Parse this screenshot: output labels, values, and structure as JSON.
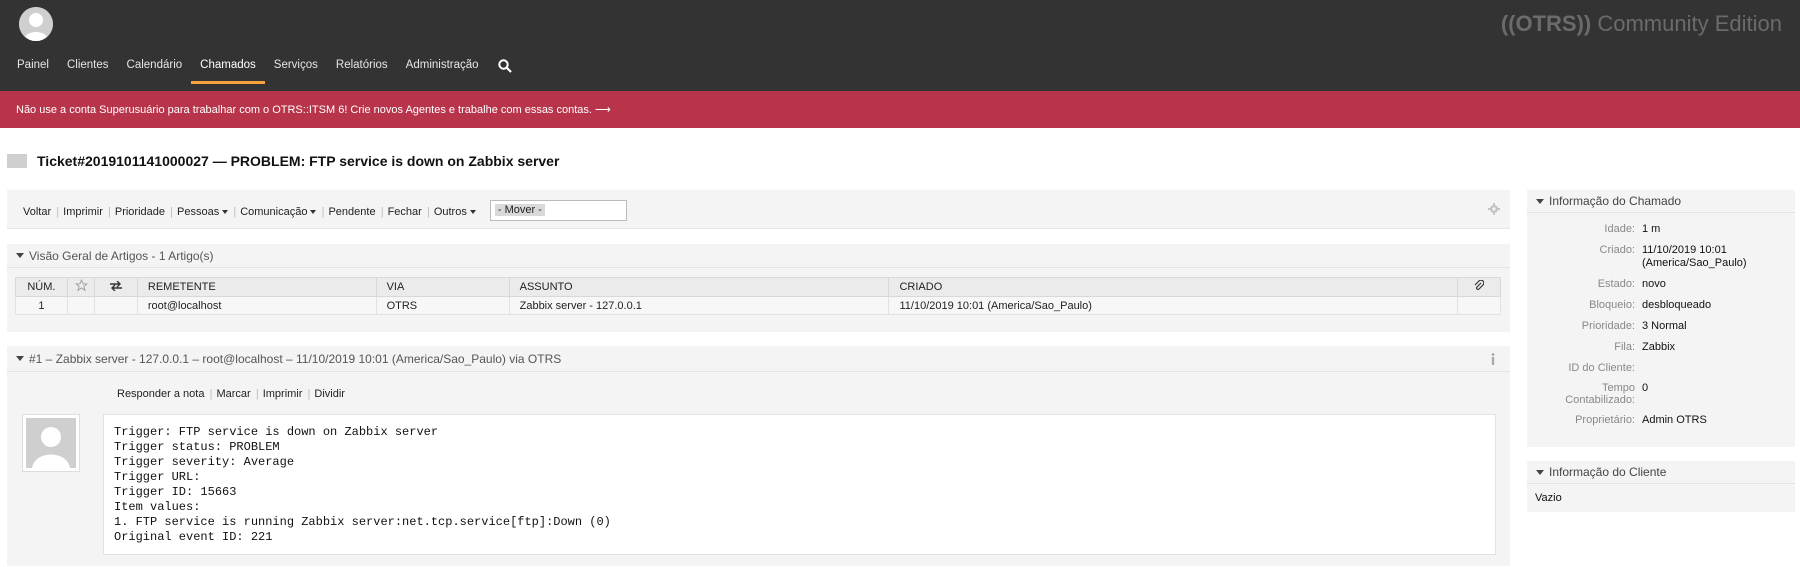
{
  "header": {
    "brand_prefix": "((OTRS))",
    "brand_suffix": " Community Edition",
    "nav": [
      {
        "label": "Painel"
      },
      {
        "label": "Clientes"
      },
      {
        "label": "Calendário"
      },
      {
        "label": "Chamados",
        "active": true
      },
      {
        "label": "Serviços"
      },
      {
        "label": "Relatórios"
      },
      {
        "label": "Administração"
      }
    ],
    "accent_color": "#f7a33b"
  },
  "warning": {
    "text": "Não use a conta Superusuário para trabalhar com o OTRS::ITSM 6! Crie novos Agentes e trabalhe com essas contas. ⟶",
    "color": "#b8344a"
  },
  "ticket": {
    "title": "Ticket#2019101141000027 — PROBLEM: FTP service is down on Zabbix server"
  },
  "actions": {
    "voltar": "Voltar",
    "imprimir": "Imprimir",
    "prioridade": "Prioridade",
    "pessoas": "Pessoas",
    "comunicacao": "Comunicação",
    "pendente": "Pendente",
    "fechar": "Fechar",
    "outros": "Outros",
    "mover": "- Mover -"
  },
  "overview": {
    "title": "Visão Geral de Artigos - 1 Artigo(s)",
    "columns": {
      "num": "NÚM.",
      "remetente": "REMETENTE",
      "via": "VIA",
      "assunto": "ASSUNTO",
      "criado": "CRIADO"
    },
    "rows": [
      {
        "num": "1",
        "remetente": "root@localhost",
        "via": "OTRS",
        "assunto": "Zabbix server - 127.0.0.1",
        "criado": "11/10/2019 10:01 (America/Sao_Paulo)"
      }
    ]
  },
  "article": {
    "header": "#1 – Zabbix server - 127.0.0.1 – root@localhost – 11/10/2019 10:01 (America/Sao_Paulo) via OTRS",
    "actions": {
      "responder": "Responder a nota",
      "marcar": "Marcar",
      "imprimir": "Imprimir",
      "dividir": "Dividir"
    },
    "body": "Trigger: FTP service is down on Zabbix server\nTrigger status: PROBLEM\nTrigger severity: Average\nTrigger URL:\nTrigger ID: 15663\nItem values:\n1. FTP service is running Zabbix server:net.tcp.service[ftp]:Down (0)\nOriginal event ID: 221"
  },
  "sidebar": {
    "ticket_info": {
      "title": "Informação do Chamado",
      "fields": [
        {
          "label": "Idade:",
          "value": "1 m"
        },
        {
          "label": "Criado:",
          "value": "11/10/2019 10:01 (America/Sao_Paulo)"
        },
        {
          "label": "Estado:",
          "value": "novo"
        },
        {
          "label": "Bloqueio:",
          "value": "desbloqueado"
        },
        {
          "label": "Prioridade:",
          "value": "3 Normal"
        },
        {
          "label": "Fila:",
          "value": "Zabbix"
        },
        {
          "label": "ID do Cliente:",
          "value": ""
        },
        {
          "label": "Tempo Contabilizado:",
          "value": "0"
        },
        {
          "label": "Proprietário:",
          "value": "Admin OTRS"
        }
      ]
    },
    "customer_info": {
      "title": "Informação do Cliente",
      "value": "Vazio"
    }
  }
}
